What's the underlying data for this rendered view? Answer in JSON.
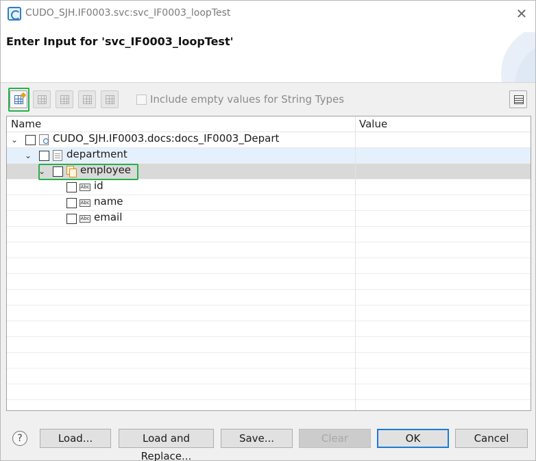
{
  "window": {
    "title": "CUDO_SJH.IF0003.svc:svc_IF0003_loopTest",
    "close_glyph": "✕"
  },
  "header": {
    "title": "Enter Input for 'svc_IF0003_loopTest'"
  },
  "toolbar": {
    "include_empty_label": "Include empty values for String Types",
    "include_empty_checked": false,
    "buttons": [
      {
        "icon": "add-row-icon",
        "enabled": true
      },
      {
        "icon": "insert-row-icon",
        "enabled": false
      },
      {
        "icon": "delete-row-icon",
        "enabled": false
      },
      {
        "icon": "edit-row-icon",
        "enabled": false
      },
      {
        "icon": "clear-row-icon",
        "enabled": false
      }
    ],
    "table_view_icon": "table-icon"
  },
  "tree": {
    "columns": [
      "Name",
      "Value"
    ],
    "rows": [
      {
        "label": "CUDO_SJH.IF0003.docs:docs_IF0003_Depart",
        "icon": "document-reference-icon",
        "expanded": true,
        "checked": false,
        "level": 0
      },
      {
        "label": "department",
        "icon": "document-icon",
        "expanded": true,
        "checked": false,
        "level": 1
      },
      {
        "label": "employee",
        "icon": "document-list-icon",
        "expanded": true,
        "checked": false,
        "level": 2
      },
      {
        "label": "id",
        "icon": "string-icon",
        "checked": false,
        "level": 3
      },
      {
        "label": "name",
        "icon": "string-icon",
        "checked": false,
        "level": 3
      },
      {
        "label": "email",
        "icon": "string-icon",
        "checked": false,
        "level": 3
      }
    ],
    "string_icon_text": "Abc",
    "twisty_glyph": "⌄"
  },
  "buttons": {
    "help": "?",
    "load": "Load...",
    "load_replace": "Load and Replace...",
    "save": "Save...",
    "clear": "Clear",
    "ok": "OK",
    "cancel": "Cancel"
  },
  "colors": {
    "highlight_box": "#27b04a",
    "selection_light": "#e4f1fc",
    "selection_gray": "#d9d9d9",
    "accent": "#1a7bd6"
  }
}
